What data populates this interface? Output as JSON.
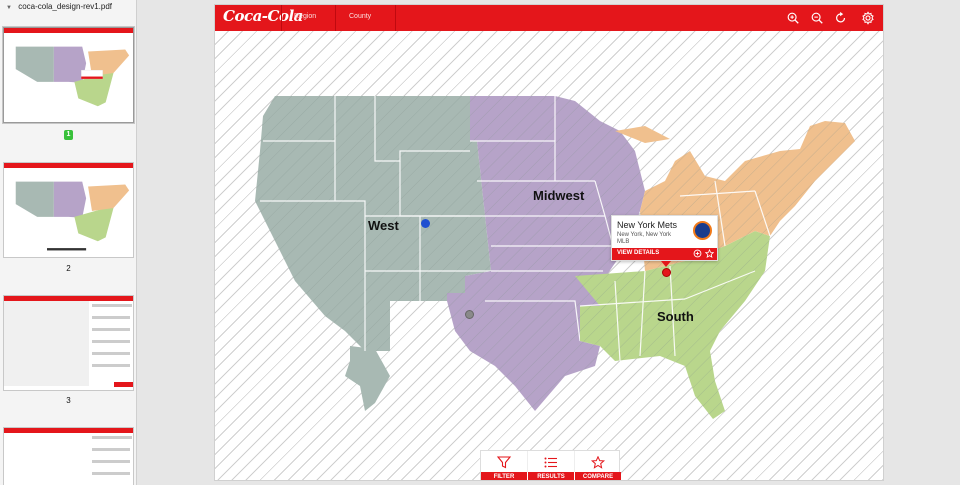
{
  "sidebar": {
    "file_name": "coca-cola_design-rev1.pdf",
    "pages": [
      {
        "label": "1",
        "selected": true
      },
      {
        "label": "2",
        "selected": false
      },
      {
        "label": "3",
        "selected": false
      },
      {
        "label": "",
        "selected": false
      }
    ]
  },
  "header": {
    "logo_text": "Coca-Cola",
    "tabs": [
      "Region",
      "County"
    ],
    "tools": [
      "zoom-in-icon",
      "zoom-out-icon",
      "refresh-icon",
      "settings-icon"
    ]
  },
  "map": {
    "regions": [
      {
        "name": "West",
        "color": "#a8b9b3"
      },
      {
        "name": "Midwest",
        "color": "#b6a3c8"
      },
      {
        "name": "South",
        "color": "#b9d68c"
      },
      {
        "name": "",
        "color": "#f0c08e"
      }
    ],
    "pins": [
      {
        "name": "blue-pin",
        "color": "#1f4fd0"
      },
      {
        "name": "gray-pin",
        "color": "#8a8a8a"
      },
      {
        "name": "red-pin",
        "color": "#e4161b"
      }
    ]
  },
  "popup": {
    "team": "New York Mets",
    "location": "New York, New York",
    "league": "MLB",
    "action": "VIEW DETAILS"
  },
  "toolbar": {
    "buttons": [
      {
        "label": "FILTER",
        "icon": "filter-icon"
      },
      {
        "label": "RESULTS",
        "icon": "list-icon"
      },
      {
        "label": "COMPARE",
        "icon": "star-icon"
      }
    ]
  },
  "colors": {
    "brand": "#e4161b",
    "badge": "#39c13b"
  }
}
